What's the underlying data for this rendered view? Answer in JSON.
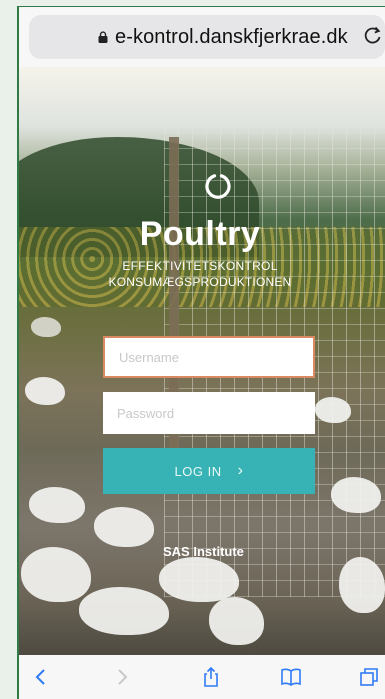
{
  "browser": {
    "url": "e-kontrol.danskfjerkrae.dk",
    "lock_icon": "lock-icon",
    "reload_icon": "reload-icon"
  },
  "brand": {
    "title": "Poultry",
    "subtitle_line1": "EFFEKTIVITETSKONTROL",
    "subtitle_line2": "KONSUMÆGSPRODUKTIONEN",
    "logo_icon": "ring-logo-icon"
  },
  "login": {
    "username_placeholder": "Username",
    "password_placeholder": "Password",
    "button_label": "LOG IN",
    "button_icon": "chevron-right-icon",
    "accent_color": "#37b3b6",
    "username_border_color": "#d98a62"
  },
  "footer": {
    "provider": "SAS Institute"
  },
  "toolbar": {
    "icons": [
      "back-icon",
      "forward-icon",
      "share-icon",
      "bookmarks-icon",
      "tabs-icon"
    ],
    "accent_color": "#2f7bf6"
  }
}
